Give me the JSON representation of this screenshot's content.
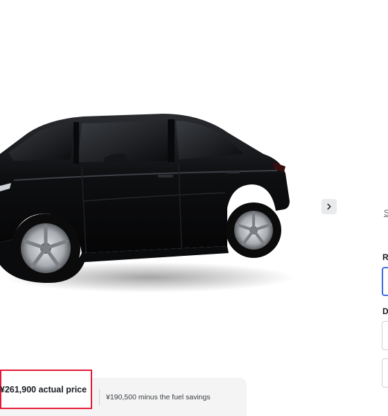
{
  "gallery": {
    "car_alt": "Model Y in Solid Black",
    "next_icon": "chevron-right-icon"
  },
  "side_panel": {
    "link_fragment": "S",
    "label_r_fragment": "R",
    "label_d_fragment": "D"
  },
  "pricing": {
    "actual_price": "¥261,900 actual price",
    "fuel_savings_price": "¥190,500 minus the fuel savings"
  },
  "colors": {
    "accent_blue": "#3e6ae1",
    "highlight_red": "#e31937",
    "car_paint": "#111214"
  }
}
